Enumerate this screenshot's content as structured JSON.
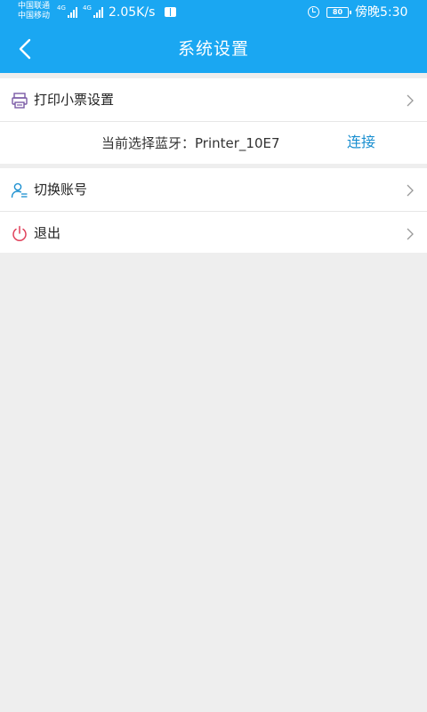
{
  "status_bar": {
    "carrier_1": "中国联通",
    "carrier_2": "中国移动",
    "network_1": "4G",
    "network_2": "4G",
    "speed": "2.05K/s",
    "battery": "80",
    "time": "傍晚5:30"
  },
  "header": {
    "title": "系统设置",
    "back_icon": "chevron-left-icon",
    "background": "#1aa7f2"
  },
  "settings": {
    "print_receipt": {
      "label": "打印小票设置",
      "icon": "printer-icon"
    },
    "bluetooth": {
      "label": "当前选择蓝牙：",
      "device": "Printer_10E7",
      "connect_label": "连接"
    },
    "switch_account": {
      "label": "切换账号",
      "icon": "user-switch-icon"
    },
    "logout": {
      "label": "退出",
      "icon": "power-icon"
    }
  },
  "colors": {
    "accent": "#1aa7f2",
    "link": "#1a8fd0",
    "background": "#eeeeee",
    "printer_icon": "#7a5aa6",
    "user_icon": "#1a8fd0",
    "power_icon": "#e0405a"
  }
}
